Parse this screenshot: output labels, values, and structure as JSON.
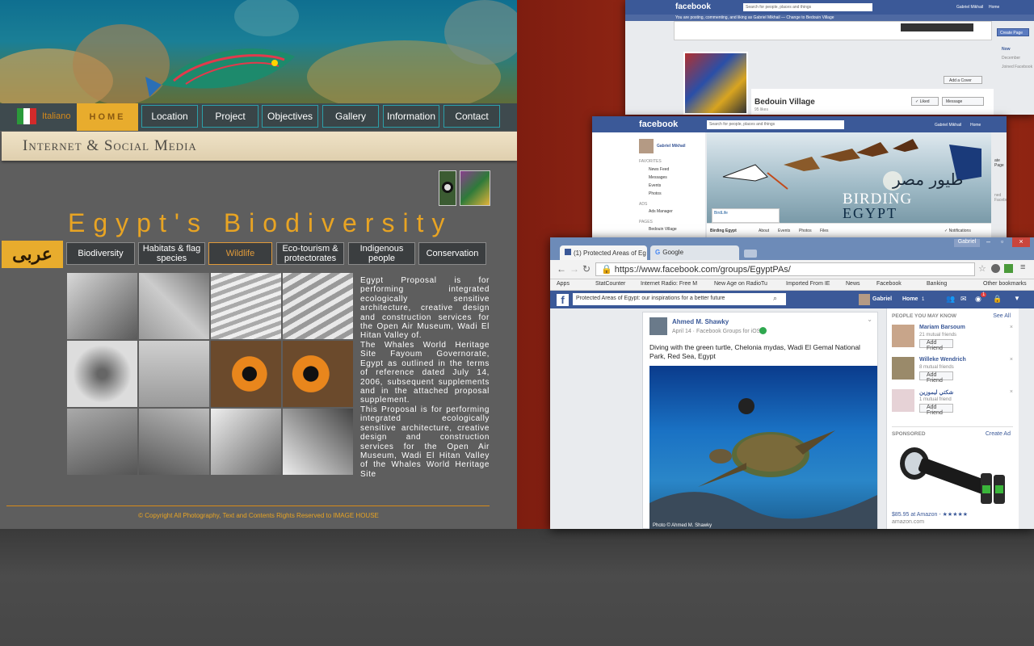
{
  "site": {
    "lang_label": "Italiano",
    "home_label": "HOME",
    "nav": [
      "Location",
      "Project",
      "Objectives",
      "Gallery",
      "Information",
      "Contact"
    ],
    "section_title": "Internet & Social Media",
    "title": "Egypt's Biodiversity",
    "arabic_label": "عربى",
    "subnav": [
      {
        "label": "Biodiversity"
      },
      {
        "label": "Habitats & flag species"
      },
      {
        "label": "Wildlife"
      },
      {
        "label": "Eco-tourism & protectorates"
      },
      {
        "label": "Indigenous people"
      },
      {
        "label": "Conservation"
      }
    ],
    "paragraphs": [
      "Egypt Proposal is for performing integrated ecologically sensitive architecture, creative design and construction services for the Open Air Museum, Wadi El Hitan Valley of.",
      "The Whales World Heritage Site Fayoum Governorate, Egypt as outlined in the terms of reference dated July 14, 2006, subsequent supplements and in the attached proposal supplement.",
      "This Proposal is for performing integrated ecologically sensitive architecture, creative design and construction services for the Open Air Museum, Wadi El Hitan Valley of the Whales World Heritage Site"
    ],
    "copyright": "© Copyright All Photography, Text and Contents Rights Reserved to IMAGE HOUSE"
  },
  "win1": {
    "logo": "facebook",
    "search_placeholder": "Search for people, places and things",
    "user": "Gabriel Mikhail",
    "home": "Home",
    "posting_note": "You are posting, commenting, and liking as Gabriel Mikhail — Change to Bedouin Village",
    "create_page": "Create Page",
    "timeline": [
      "Now",
      "December",
      "Joined Facebook"
    ],
    "add_cover": "Add a Cover",
    "page_name": "Bedouin Village",
    "likes": "95 likes",
    "liked": "✓ Liked",
    "message": "Message"
  },
  "win2": {
    "logo": "facebook",
    "search_placeholder": "Search for people, places and things",
    "user": "Gabriel Mikhail",
    "home": "Home",
    "profile": "Gabriel Mikhail",
    "favorites_header": "FAVORITES",
    "favorites": [
      "News Feed",
      "Messages",
      "Events",
      "Photos"
    ],
    "ads_header": "ADS",
    "ads_manager": "Ads Manager",
    "pages_header": "PAGES",
    "pages": [
      "Bedouin Village"
    ],
    "cover_arabic": "طيور مصر",
    "cover_word1": "BIRDING",
    "cover_word2": "EGYPT",
    "page_name": "Birding Egypt",
    "tabs": [
      "About",
      "Events",
      "Photos",
      "Files"
    ],
    "notifications": "✓ Notifications",
    "partner_logo": "BirdLife",
    "side_partial_1": "ate Page",
    "side_partial_2": "ned Facebo"
  },
  "win3": {
    "tab_active": "(1) Protected Areas of Eg",
    "tab_google": "Google",
    "profile_btn": "Gabriel",
    "url": "https://www.facebook.com/groups/EgyptPAs/",
    "bookmarks": [
      "Apps",
      "StatCounter",
      "Internet Radio: Free M",
      "New Age on RadioTu",
      "Imported From IE",
      "News",
      "Facebook",
      "Banking",
      "Other bookmarks"
    ],
    "group_search": "Protected Areas of Egypt: our inspirations for a better future",
    "user": "Gabriel",
    "home": "Home",
    "home_count": "1",
    "notif_count": "1",
    "post": {
      "author": "Ahmed M. Shawky",
      "meta": "April 14 · Facebook Groups for iOS",
      "text": "Diving with the green turtle, Chelonia mydas, Wadi El Gemal National Park, Red Sea, Egypt",
      "photo_credit": "Photo © Ahmed M. Shawky"
    },
    "people_header": "PEOPLE YOU MAY KNOW",
    "see_all": "See All",
    "people": [
      {
        "name": "Mariam Barsoum",
        "mutual": "21 mutual friends"
      },
      {
        "name": "Willeke Wendrich",
        "mutual": "8 mutual friends"
      },
      {
        "name": "شكتي ليموزين",
        "mutual": "1 mutual friend"
      }
    ],
    "add_friend": "Add Friend",
    "sponsored": "SPONSORED",
    "create_ad": "Create Ad",
    "ad_price": "$85.95 at Amazon - ★★★★★",
    "ad_site": "amazon.com"
  }
}
